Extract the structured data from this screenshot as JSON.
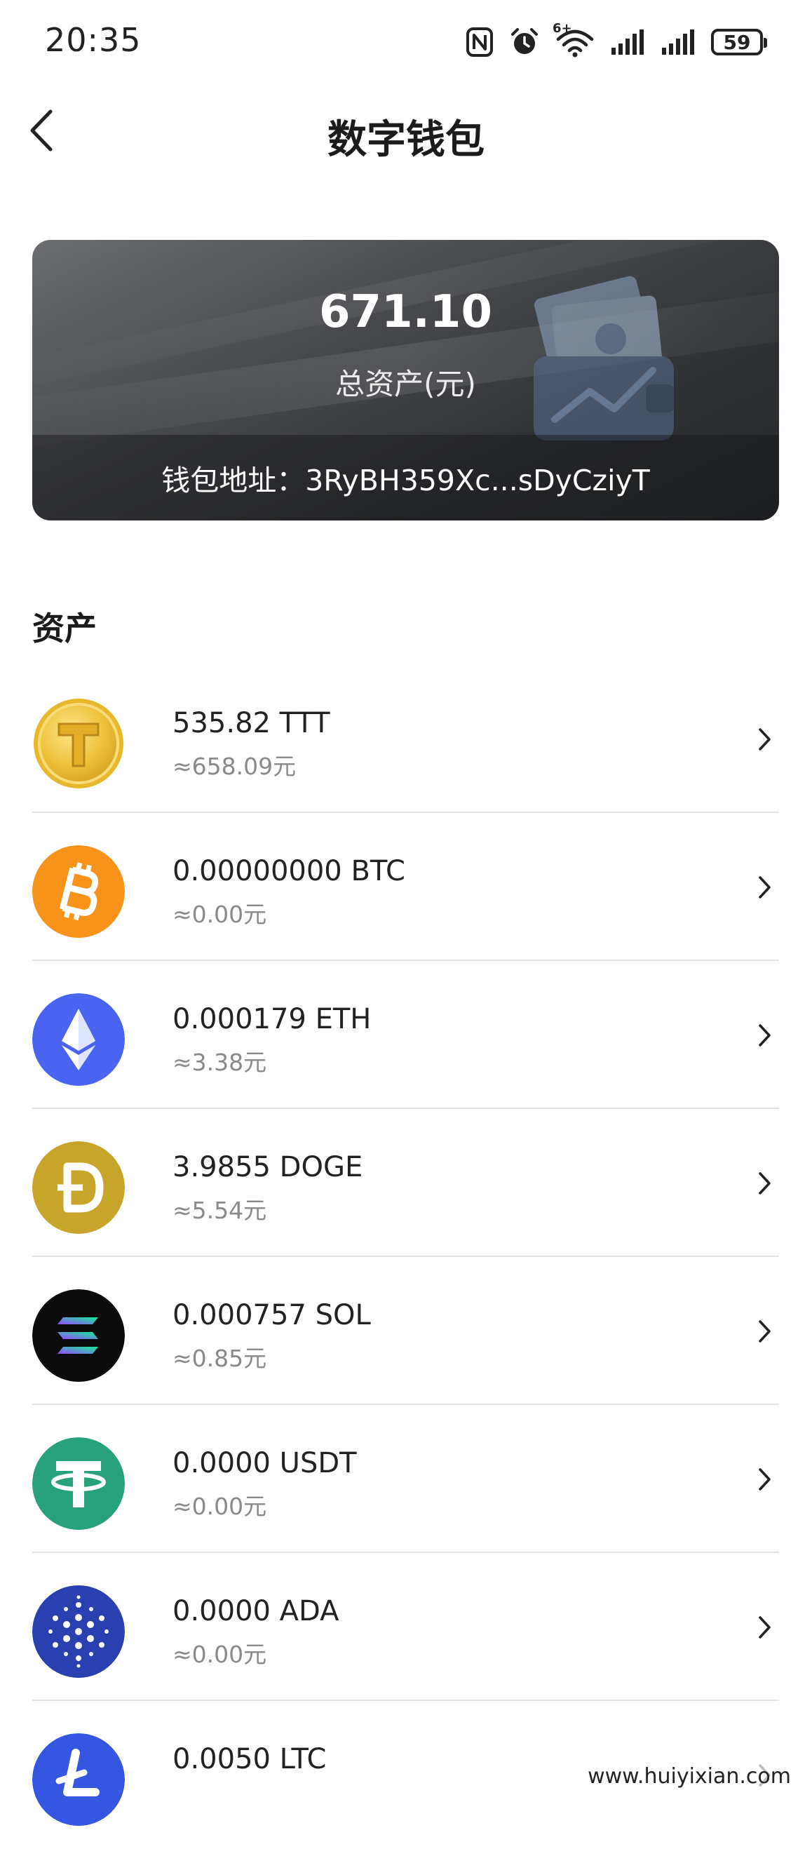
{
  "status_bar": {
    "time": "20:35",
    "battery": "59",
    "network_badge": "6+",
    "icons": [
      "nfc-icon",
      "alarm-icon",
      "wifi-icon",
      "signal-icon",
      "signal-icon",
      "battery-icon"
    ]
  },
  "header": {
    "title": "数字钱包",
    "back_icon": "back-arrow-icon"
  },
  "wallet_card": {
    "total_amount": "671.10",
    "total_label": "总资产(元)",
    "address_text": "钱包地址：3RyBH359Xc...sDyCziyT"
  },
  "assets": {
    "section_title": "资产",
    "items": [
      {
        "amount": "535.82 TTT",
        "value": "≈658.09元",
        "icon": "ttt-coin-icon",
        "color": "#e9b72c"
      },
      {
        "amount": "0.00000000 BTC",
        "value": "≈0.00元",
        "icon": "btc-coin-icon",
        "color": "#f7931a"
      },
      {
        "amount": "0.000179 ETH",
        "value": "≈3.38元",
        "icon": "eth-coin-icon",
        "color": "#4a63f0"
      },
      {
        "amount": "3.9855 DOGE",
        "value": "≈5.54元",
        "icon": "doge-coin-icon",
        "color": "#c6a52a"
      },
      {
        "amount": "0.000757 SOL",
        "value": "≈0.85元",
        "icon": "sol-coin-icon",
        "color": "#0b0b0b"
      },
      {
        "amount": "0.0000 USDT",
        "value": "≈0.00元",
        "icon": "usdt-coin-icon",
        "color": "#26a17b"
      },
      {
        "amount": "0.0000 ADA",
        "value": "≈0.00元",
        "icon": "ada-coin-icon",
        "color": "#2a3fb0"
      },
      {
        "amount": "0.0050 LTC",
        "value": "",
        "icon": "ltc-coin-icon",
        "color": "#3456e0"
      }
    ]
  },
  "watermark": "www.huiyixian.com"
}
